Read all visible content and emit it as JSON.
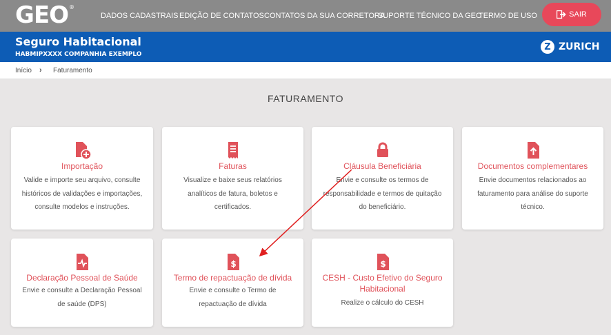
{
  "header": {
    "logo_text": "GEO",
    "logo_reg": "®",
    "nav": [
      "DADOS CADASTRAIS",
      "EDIÇÃO DE CONTATOS",
      "CONTATOS DA SUA CORRETORA",
      "SUPORTE TÉCNICO DA GEO",
      "TERMO DE USO"
    ],
    "logout_label": "SAIR"
  },
  "banner": {
    "title": "Seguro Habitacional",
    "subtitle": "HABMIPXXXX COMPANHIA EXEMPLO",
    "brand": "ZURICH",
    "brand_initial": "Z"
  },
  "breadcrumb": [
    "Início",
    "Faturamento"
  ],
  "page": {
    "heading": "FATURAMENTO"
  },
  "cards": [
    {
      "title": "Importação",
      "desc": [
        "Valide e importe seu arquivo, consulte",
        "históricos de validações e importações,",
        "consulte modelos e instruções."
      ],
      "icon": "file-add-icon"
    },
    {
      "title": "Faturas",
      "desc": [
        "Visualize e baixe seus relatórios",
        "analíticos de fatura, boletos e",
        "certificados."
      ],
      "icon": "receipt-icon"
    },
    {
      "title": "Cláusula Beneficiária",
      "desc": [
        "Envie e consulte os termos de",
        "responsabilidade e termos de quitação",
        "do beneficiário."
      ],
      "icon": "lock-icon"
    },
    {
      "title": "Documentos complementares",
      "desc": [
        "Envie documentos relacionados ao",
        "faturamento para análise do suporte",
        "técnico."
      ],
      "icon": "file-upload-icon"
    },
    {
      "title": "Declaração Pessoal de Saúde",
      "desc": [
        "Envie e consulte a Declaração Pessoal",
        "de saúde (DPS)"
      ],
      "icon": "health-file-icon"
    },
    {
      "title": "Termo de repactuação de dívida",
      "desc": [
        "Envie e consulte o Termo de",
        "repactuação de dívida"
      ],
      "icon": "dollar-file-icon"
    },
    {
      "title_lines": [
        "CESH - Custo Efetivo do Seguro",
        "Habitacional"
      ],
      "desc": [
        "Realize o cálculo do CESH"
      ],
      "icon": "dollar-file-icon"
    }
  ],
  "colors": {
    "accent": "#e0525a",
    "brand_blue": "#0d5cb5",
    "topbar": "#8a8a8a",
    "logout": "#e8485a"
  }
}
